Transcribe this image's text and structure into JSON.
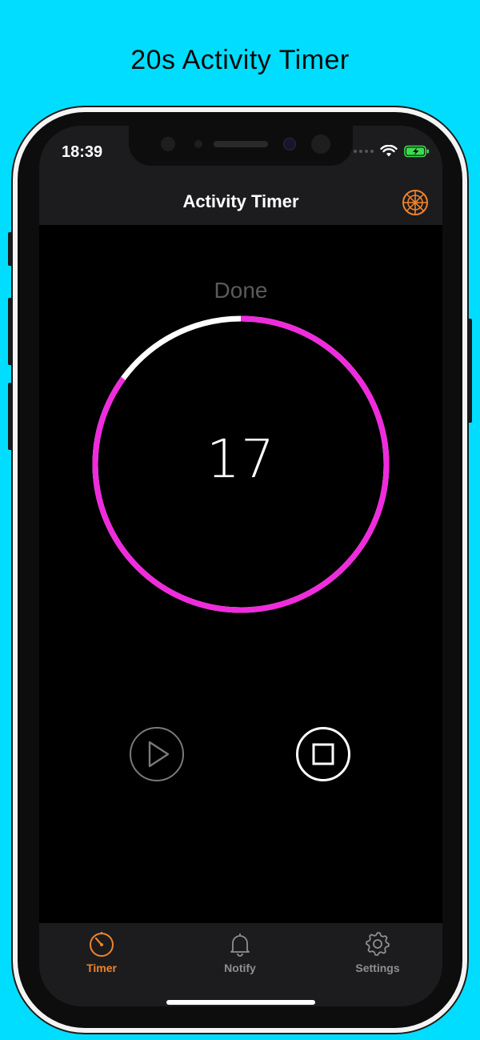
{
  "promo": {
    "title": "20s Activity Timer"
  },
  "status_bar": {
    "time": "18:39",
    "icons": [
      "signal-dots-icon",
      "wifi-icon",
      "battery-charging-icon"
    ]
  },
  "nav": {
    "title": "Activity Timer",
    "right_icon": "wheel-icon"
  },
  "timer": {
    "status": "Done",
    "remaining": "17",
    "total_seconds": 20,
    "elapsed_seconds": 3,
    "progress_color": "#F02BDD",
    "elapsed_color": "#FFFFFF"
  },
  "controls": {
    "play_icon": "play-icon",
    "stop_icon": "stop-icon"
  },
  "tabs": [
    {
      "label": "Timer",
      "icon": "timer-icon",
      "active": true
    },
    {
      "label": "Notify",
      "icon": "bell-icon",
      "active": false
    },
    {
      "label": "Settings",
      "icon": "gear-icon",
      "active": false
    }
  ],
  "colors": {
    "background": "#00DDFF",
    "accent": "#F0832B",
    "inactive_tab": "#8E8E93",
    "nav_bg": "#1C1C1E"
  }
}
